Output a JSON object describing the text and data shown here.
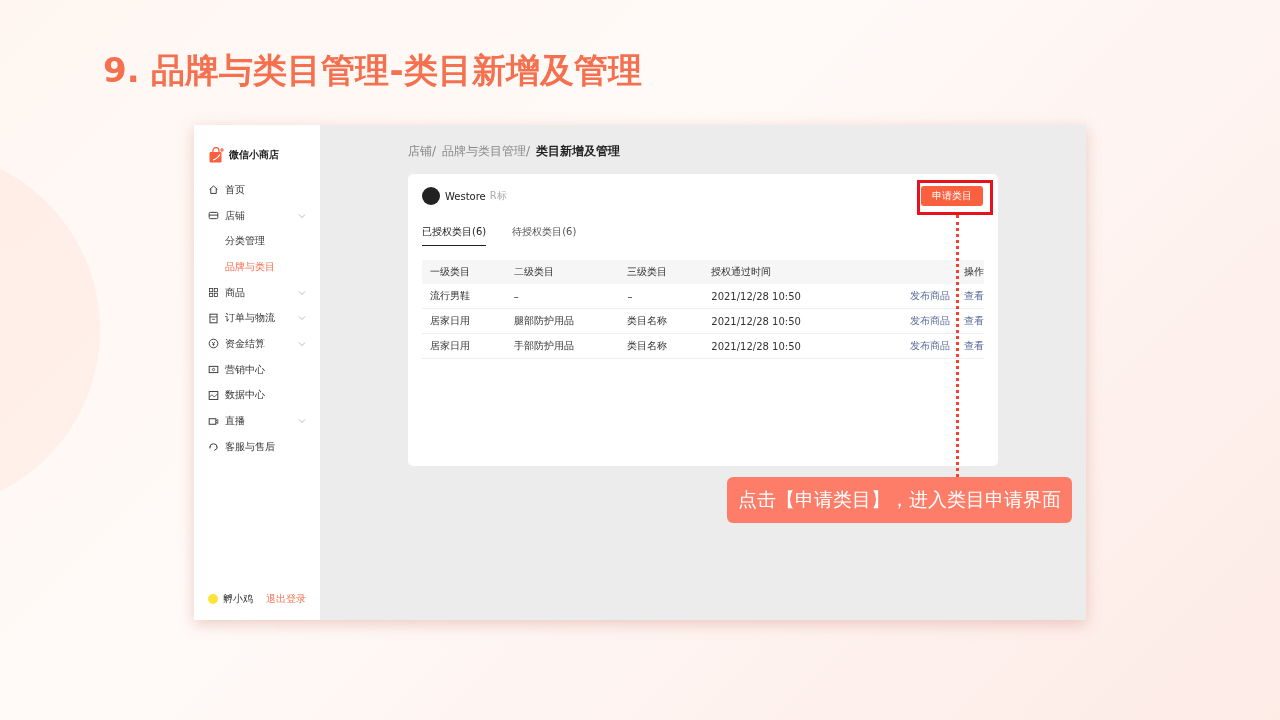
{
  "slide_title": "9. 品牌与类目管理-类目新增及管理",
  "sidebar": {
    "logo_text": "微信小商店",
    "items": [
      {
        "label": "首页",
        "expandable": false,
        "selected": false
      },
      {
        "label": "店铺",
        "expandable": true,
        "selected": false,
        "children": [
          {
            "label": "分类管理",
            "selected": false
          },
          {
            "label": "品牌与类目",
            "selected": true
          }
        ]
      },
      {
        "label": "商品",
        "expandable": true,
        "selected": false
      },
      {
        "label": "订单与物流",
        "expandable": true,
        "selected": false
      },
      {
        "label": "资金结算",
        "expandable": true,
        "selected": false
      },
      {
        "label": "营销中心",
        "expandable": false,
        "selected": false
      },
      {
        "label": "数据中心",
        "expandable": false,
        "selected": false
      },
      {
        "label": "直播",
        "expandable": true,
        "selected": false
      },
      {
        "label": "客服与售后",
        "expandable": false,
        "selected": false
      }
    ],
    "user": {
      "name": "孵小鸡",
      "logout": "退出登录"
    }
  },
  "breadcrumb": [
    "店铺/",
    "品牌与类目管理/",
    "类目新增及管理"
  ],
  "card": {
    "brand": {
      "name": "Westore",
      "tag": "R标"
    },
    "apply_button": "申请类目",
    "tabs": [
      {
        "label": "已授权类目(6)",
        "selected": true
      },
      {
        "label": "待授权类目(6)",
        "selected": false
      }
    ],
    "table": {
      "columns": [
        "一级类目",
        "二级类目",
        "三级类目",
        "授权通过时间",
        "操作"
      ],
      "rows": [
        {
          "cells": [
            "流行男鞋",
            "–",
            "–",
            "2021/12/28  10:50"
          ],
          "actions": [
            "发布商品",
            "查看"
          ]
        },
        {
          "cells": [
            "居家日用",
            "腿部防护用品",
            "类目名称",
            "2021/12/28  10:50"
          ],
          "actions": [
            "发布商品",
            "查看"
          ]
        },
        {
          "cells": [
            "居家日用",
            "手部防护用品",
            "类目名称",
            "2021/12/28  10:50"
          ],
          "actions": [
            "发布商品",
            "查看"
          ]
        }
      ]
    }
  },
  "callout": "点击【申请类目】，进入类目申请界面"
}
